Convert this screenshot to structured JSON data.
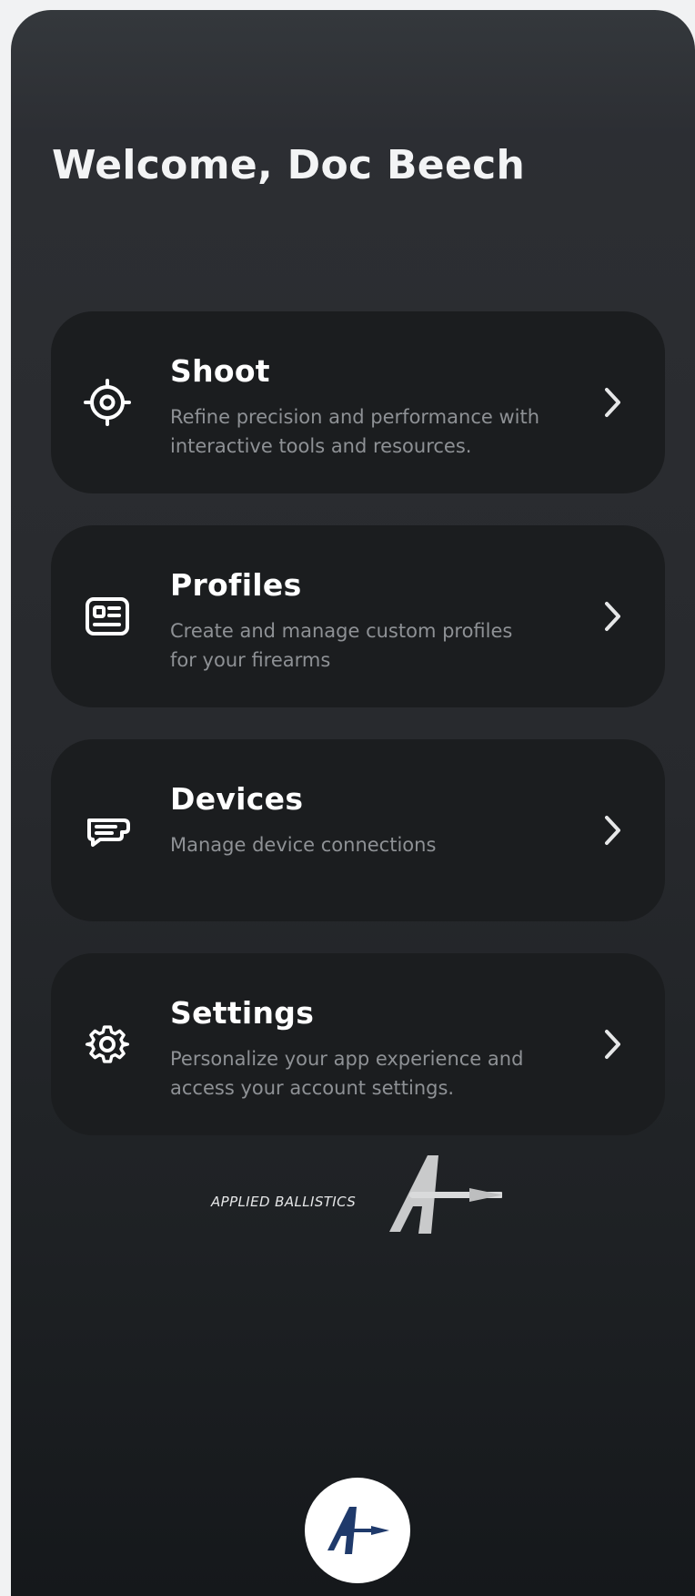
{
  "header": {
    "welcome": "Welcome, Doc Beech"
  },
  "menu": [
    {
      "id": "shoot",
      "icon": "crosshair-icon",
      "title": "Shoot",
      "description": "Refine precision and performance with interactive tools and resources."
    },
    {
      "id": "profiles",
      "icon": "id-card-icon",
      "title": "Profiles",
      "description": "Create and manage custom profiles for your firearms"
    },
    {
      "id": "devices",
      "icon": "device-icon",
      "title": "Devices",
      "description": "Manage device connections"
    },
    {
      "id": "settings",
      "icon": "gear-icon",
      "title": "Settings",
      "description": "Personalize your app experience and access your account settings."
    }
  ],
  "brand": {
    "name": "APPLIED BALLISTICS",
    "logo_icon": "applied-ballistics-logo"
  },
  "bottom": {
    "home_icon": "applied-ballistics-home-icon"
  },
  "colors": {
    "background_top": "#34383c",
    "background_bottom": "#15181b",
    "card": "#1b1d1f",
    "text_primary": "#ffffff",
    "text_secondary": "#8e9195",
    "home_button": "#ffffff",
    "home_logo": "#1f3a6b"
  }
}
